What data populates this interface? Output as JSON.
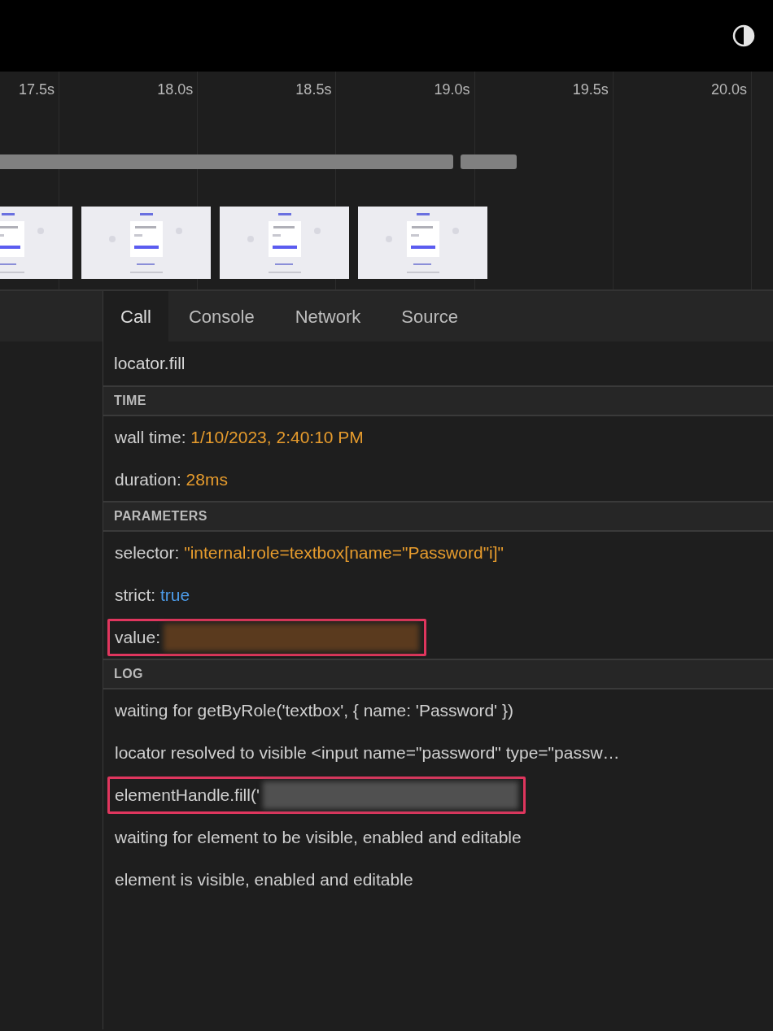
{
  "timeline": {
    "ticks": [
      "17.5s",
      "18.0s",
      "18.5s",
      "19.0s",
      "19.5s",
      "20.0s"
    ]
  },
  "tabs": [
    {
      "label": "Call",
      "selected": true
    },
    {
      "label": "Console",
      "selected": false
    },
    {
      "label": "Network",
      "selected": false
    },
    {
      "label": "Source",
      "selected": false
    }
  ],
  "call": {
    "title": "locator.fill",
    "sections": [
      {
        "heading": "TIME",
        "rows": [
          {
            "kind": "string",
            "key": "wall time:",
            "value": "1/10/2023, 2:40:10 PM",
            "highlighted": false
          },
          {
            "kind": "string",
            "key": "duration:",
            "value": "28ms",
            "highlighted": false
          }
        ]
      },
      {
        "heading": "PARAMETERS",
        "rows": [
          {
            "kind": "string",
            "key": "selector:",
            "value": "\"internal:role=textbox[name=\"Password\"i]\"",
            "highlighted": false
          },
          {
            "kind": "boolean",
            "key": "strict:",
            "value": "true",
            "highlighted": false
          },
          {
            "kind": "redacted",
            "key": "value:",
            "color": "#5a3a1e",
            "highlighted": true
          }
        ]
      },
      {
        "heading": "LOG",
        "rows": [
          {
            "kind": "line",
            "text": "waiting for getByRole('textbox', { name: 'Password' })",
            "highlighted": false
          },
          {
            "kind": "line",
            "text": "locator resolved to visible <input name=\"password\" type=\"passw…",
            "highlighted": false
          },
          {
            "kind": "redacted",
            "key": "elementHandle.fill('",
            "color": "#505050",
            "highlighted": true
          },
          {
            "kind": "line",
            "text": "waiting for element to be visible, enabled and editable",
            "highlighted": false
          },
          {
            "kind": "line",
            "text": "element is visible, enabled and editable",
            "highlighted": false
          }
        ]
      }
    ]
  }
}
